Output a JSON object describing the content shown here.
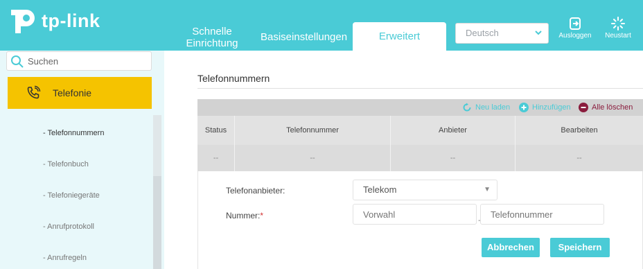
{
  "brand": {
    "name": "tp-link"
  },
  "nav": {
    "quick_setup_line1": "Schnelle",
    "quick_setup_line2": "Einrichtung",
    "basic_settings": "Basiseinstellungen",
    "advanced": "Erweitert"
  },
  "language": {
    "selected": "Deutsch"
  },
  "header_actions": {
    "logout": "Ausloggen",
    "reboot": "Neustart"
  },
  "sidebar": {
    "search_placeholder": "Suchen",
    "active_category": "Telefonie",
    "items": [
      {
        "label": "- Telefonnummern",
        "current": true
      },
      {
        "label": "- Telefonbuch",
        "current": false
      },
      {
        "label": "- Telefoniegeräte",
        "current": false
      },
      {
        "label": "- Anrufprotokoll",
        "current": false
      },
      {
        "label": "- Anrufregeln",
        "current": false
      }
    ]
  },
  "section": {
    "title": "Telefonnummern"
  },
  "toolbar": {
    "reload": "Neu laden",
    "add": "Hinzufügen",
    "delete_all": "Alle löschen"
  },
  "table": {
    "columns": [
      "Status",
      "Telefonnummer",
      "Anbieter",
      "Bearbeiten"
    ],
    "rows": [
      [
        "--",
        "--",
        "--",
        "--"
      ]
    ]
  },
  "form": {
    "provider_label": "Telefonanbieter:",
    "provider_value": "Telekom",
    "number_label": "Nummer:",
    "required_mark": "*",
    "area_code_placeholder": "Vorwahl",
    "number_placeholder": "Telefonnummer",
    "separator": "-",
    "cancel": "Abbrechen",
    "save": "Speichern"
  },
  "colors": {
    "brand_teal": "#4acbd6",
    "active_yellow": "#f5c300",
    "delete_red": "#8a1c3d",
    "sidebar_bg": "#e8f8fa"
  },
  "icons": {
    "logout": "logout-icon",
    "reboot": "reboot-icon",
    "search": "search-icon",
    "telephony": "phone-icon",
    "reload": "reload-icon",
    "add": "plus-icon",
    "delete_all": "minus-icon"
  }
}
